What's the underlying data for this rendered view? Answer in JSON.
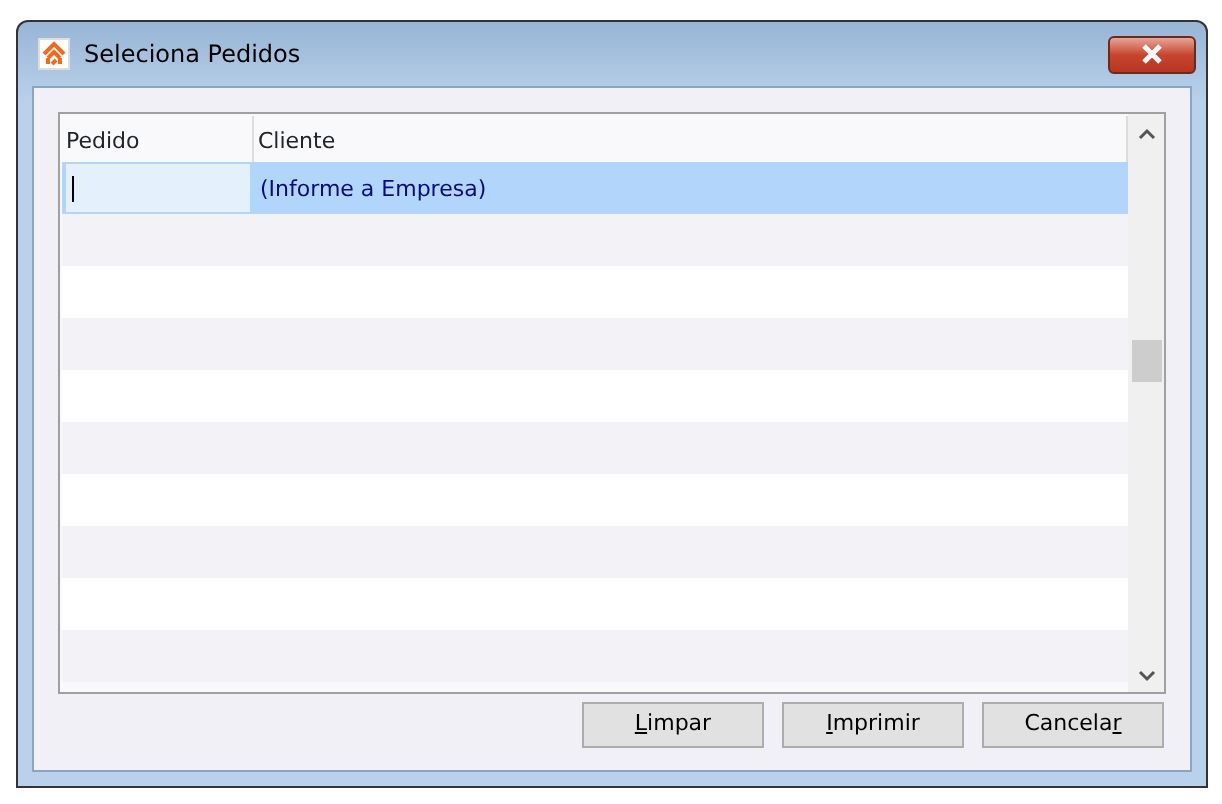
{
  "window": {
    "title": "Seleciona Pedidos"
  },
  "table": {
    "columns": [
      "Pedido",
      "Cliente"
    ],
    "rows": [
      {
        "cliente": "(Informe a Empresa)",
        "selected": true,
        "editing": true
      },
      {
        "selected": false
      },
      {
        "selected": false
      },
      {
        "selected": false
      },
      {
        "selected": false
      },
      {
        "selected": false
      },
      {
        "selected": false
      },
      {
        "selected": false
      },
      {
        "selected": false
      },
      {
        "selected": false
      }
    ]
  },
  "buttons": [
    {
      "key": "L",
      "after": "impar"
    },
    {
      "key": "I",
      "after": "mprimir"
    },
    {
      "before": "Cancela",
      "key": "r"
    }
  ]
}
